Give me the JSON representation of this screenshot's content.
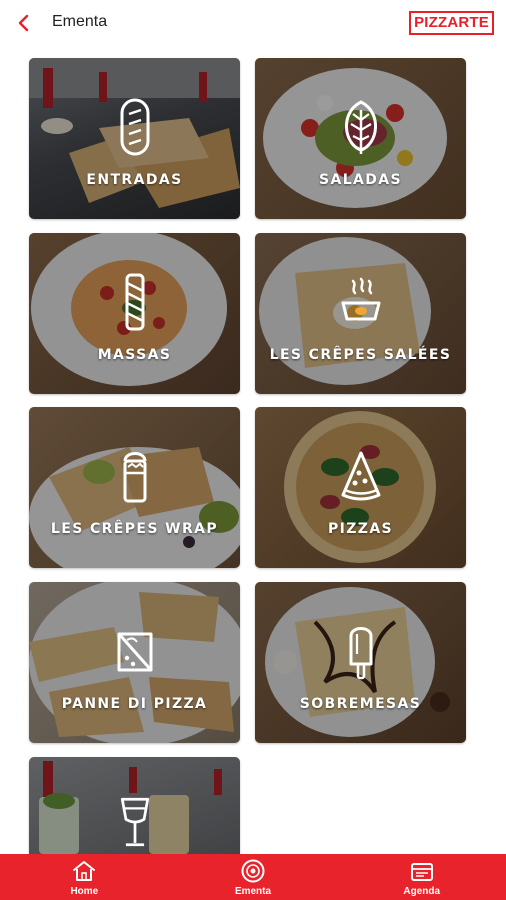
{
  "header": {
    "back_icon": "chevron-left-icon",
    "title": "Ementa",
    "logo_text": "PIZZARTE",
    "accent": "#e8202a"
  },
  "categories": [
    {
      "label": "ENTRADAS",
      "icon": "bread-icon"
    },
    {
      "label": "SALADAS",
      "icon": "lettuce-icon"
    },
    {
      "label": "MASSAS",
      "icon": "pasta-icon"
    },
    {
      "label": "LES CRÊPES SALÉES",
      "icon": "egg-pan-icon"
    },
    {
      "label": "LES CRÊPES WRAP",
      "icon": "wrap-icon"
    },
    {
      "label": "PIZZAS",
      "icon": "pizza-slice-icon"
    },
    {
      "label": "PANNE DI PIZZA",
      "icon": "sandwich-icon"
    },
    {
      "label": "SOBREMESAS",
      "icon": "popsicle-icon"
    },
    {
      "label": "",
      "icon": "glass-icon"
    }
  ],
  "bottom_nav": {
    "items": [
      {
        "label": "Home",
        "icon": "home-icon"
      },
      {
        "label": "Ementa",
        "icon": "plate-icon"
      },
      {
        "label": "Agenda",
        "icon": "calendar-icon"
      }
    ],
    "background": "#e8232b"
  }
}
